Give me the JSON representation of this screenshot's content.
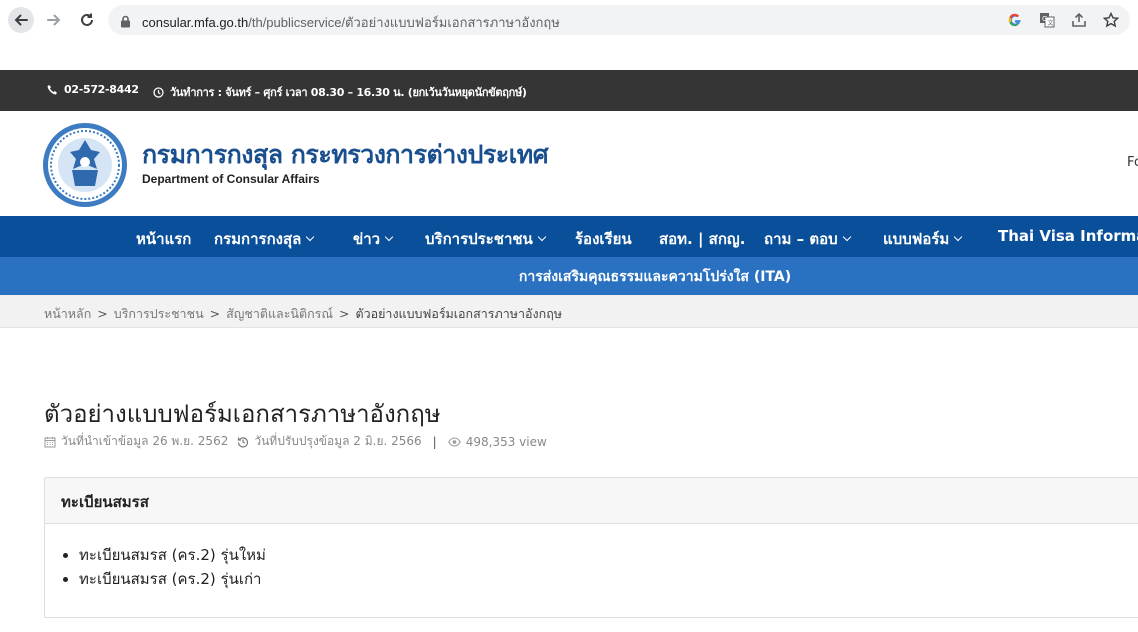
{
  "browser": {
    "url_host": "consular.mfa.go.th",
    "url_path": "/th/publicservice/ตัวอย่างแบบฟอร์มเอกสารภาษาอังกฤษ"
  },
  "topbar": {
    "phone": "02-572-8442",
    "hours": "วันทำการ : จันทร์ – ศุกร์ เวลา 08.30 – 16.30 น. (ยกเว้นวันหยุดนักขัตฤกษ์)"
  },
  "header": {
    "title": "กรมการกงสุล กระทรวงการต่างประเทศ",
    "subtitle": "Department of Consular Affairs",
    "right_text": "Fo"
  },
  "nav": {
    "home": "หน้าแรก",
    "dept": "กรมการกงสุล",
    "news": "ข่าว",
    "services": "บริการประชาชน",
    "complaints": "ร้องเรียน",
    "ombudsman": "สอท. | สกญ.",
    "faq": "ถาม – ตอบ",
    "forms": "แบบฟอร์ม",
    "visa": "Thai Visa Information"
  },
  "ita": {
    "label": "การส่งเสริมคุณธรรมและความโปร่งใส (ITA)"
  },
  "breadcrumb": {
    "home": "หน้าหลัก",
    "services": "บริการประชาชน",
    "nationality": "สัญชาติและนิติกรณ์",
    "current": "ตัวอย่างแบบฟอร์มเอกสารภาษาอังกฤษ"
  },
  "article": {
    "title": "ตัวอย่างแบบฟอร์มเอกสารภาษาอังกฤษ",
    "created": "วันที่นำเข้าข้อมูล 26 พ.ย. 2562",
    "updated": "วันที่ปรับปรุงข้อมูล 2 มิ.ย. 2566",
    "divider": "|",
    "views": "498,353 view"
  },
  "section": {
    "heading": "ทะเบียนสมรส",
    "links": [
      "ทะเบียนสมรส (คร.2) รุ่นใหม่",
      "ทะเบียนสมรส (คร.2) รุ่นเก่า"
    ]
  },
  "colors": {
    "nav": "#0a4f9a",
    "ita": "#2a72c1",
    "topbar": "#353535",
    "title": "#1a4f8f"
  }
}
